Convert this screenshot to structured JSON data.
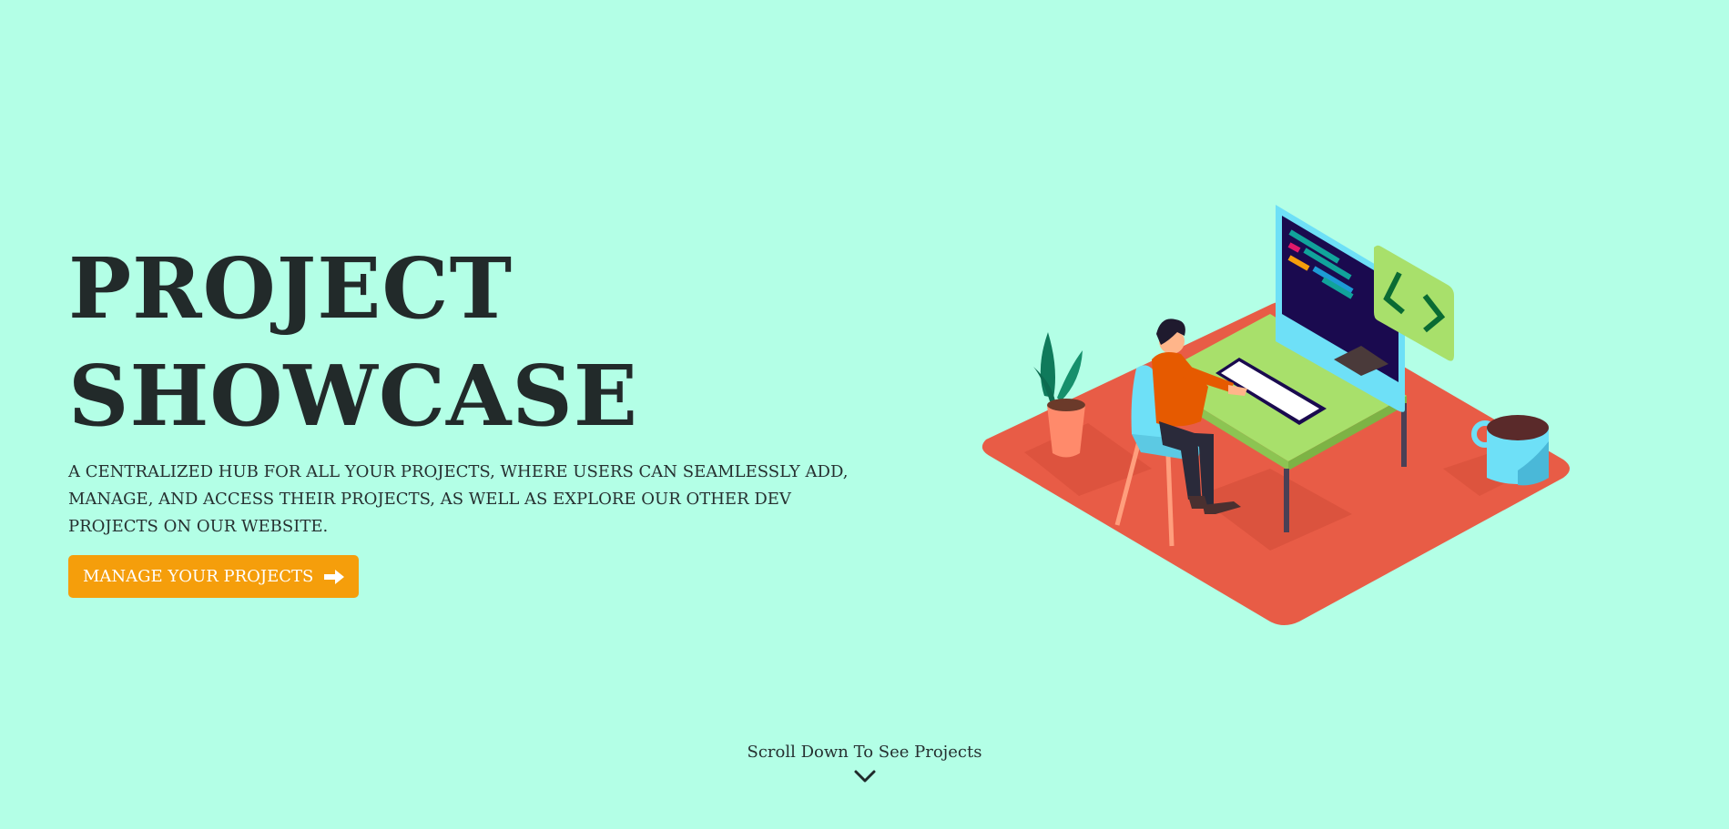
{
  "hero": {
    "title_line1": "PROJECT",
    "title_line2": "SHOWCASE",
    "description": "A CENTRALIZED HUB FOR ALL YOUR PROJECTS, WHERE USERS CAN SEAMLESSLY ADD, MANAGE, AND ACCESS THEIR PROJECTS, AS WELL AS EXPLORE OUR OTHER DEV PROJECTS ON OUR WEBSITE.",
    "cta_label": "MANAGE YOUR PROJECTS",
    "cta_icon": "arrow-right-icon"
  },
  "illustration": {
    "name": "developer-at-desk-illustration",
    "monitor_icon": "code-brackets-icon"
  },
  "scroll": {
    "label": "Scroll Down To See Projects",
    "icon": "chevron-down-icon"
  },
  "colors": {
    "background": "#b3ffe6",
    "accent": "#f59e0b",
    "text": "#222a2a",
    "floor": "#e85c46"
  }
}
